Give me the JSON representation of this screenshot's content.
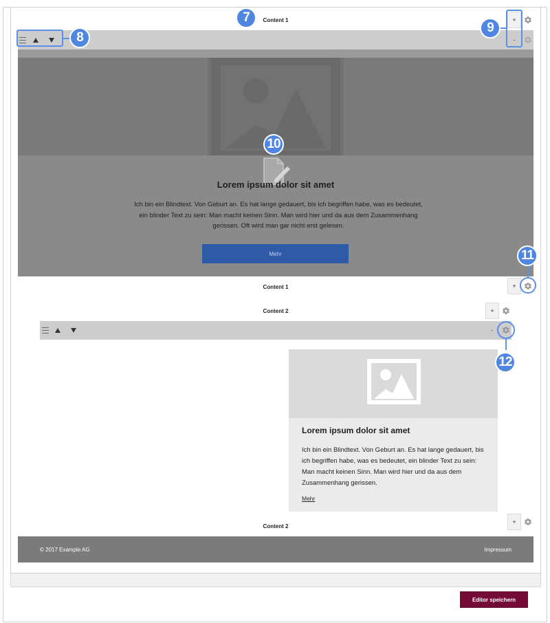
{
  "section1": {
    "label_top": "Content 1",
    "label_bottom": "Content 1",
    "add_label": "+",
    "remove_label": "-",
    "hero": {
      "title": "Lorem ipsum dolor sit amet",
      "text": "Ich bin ein Blindtext. Von Geburt an. Es hat lange gedauert, bis ich begriffen habe, was es bedeutet, ein blinder Text zu sein: Man macht keinen Sinn. Man wird hier und da aus dem Zusammenhang gerissen. Oft wird man gar nicht erst gelesen.",
      "button_label": "Mehr"
    }
  },
  "section2": {
    "label_top": "Content 2",
    "label_bottom": "Content 2",
    "add_label": "+",
    "remove_label": "-",
    "card": {
      "title": "Lorem ipsum dolor sit amet",
      "text": "Ich bin ein Blindtext. Von Geburt an. Es hat lange gedauert, bis ich begriffen habe, was es bedeutet, ein blinder Text zu sein: Man macht keinen Sinn. Man wird hier und da aus dem Zusammenhang gerissen.",
      "link_label": "Mehr"
    }
  },
  "footer": {
    "copyright": "© 2017 Example AG",
    "imprint": "Impressum"
  },
  "save_button": "Editor speichern",
  "callouts": [
    "7",
    "8",
    "9",
    "10",
    "11",
    "12"
  ],
  "icons": {
    "drag": "hamburger-icon",
    "up": "arrow-up-icon",
    "down": "arrow-down-icon",
    "settings": "gear-icon",
    "edit": "edit-document-icon",
    "image": "image-placeholder-icon"
  },
  "colors": {
    "callout": "#4f86e2",
    "save_button": "#740a36",
    "hero_button": "#2e5aa8",
    "footer": "#7b7b7b",
    "toolbar": "#cdcdcd"
  }
}
